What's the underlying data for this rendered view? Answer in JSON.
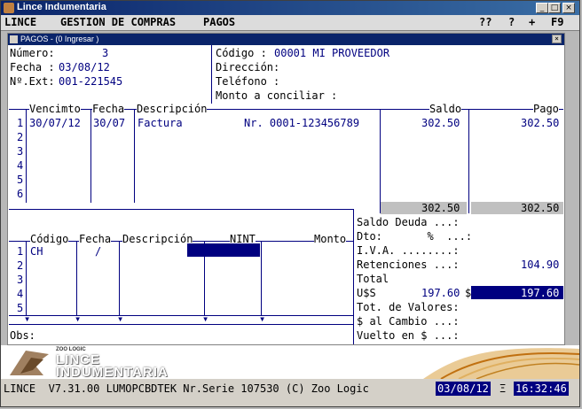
{
  "window": {
    "title": "Lince Indumentaria",
    "min": "_",
    "max": "□",
    "close": "×"
  },
  "menu": {
    "items": [
      "LINCE",
      "GESTION DE COMPRAS",
      "PAGOS"
    ],
    "right": [
      "??",
      "?",
      "+",
      "F9"
    ]
  },
  "subwindow": {
    "title": "PAGOS - (0  Ingresar )",
    "close": "×"
  },
  "header": {
    "numero_label": "Número:",
    "numero_value": "3",
    "fecha_label": "Fecha :",
    "fecha_value": "03/08/12",
    "next_label": "Nº.Ext:",
    "next_value": "001-221545",
    "codigo_label": "Código :",
    "codigo_value": "00001 MI PROVEEDOR",
    "direccion_label": "Dirección:",
    "telefono_label": "Teléfono :",
    "monto_label": "Monto a conciliar :"
  },
  "grid1": {
    "headers": {
      "vencimto": "Vencimto",
      "fecha": "Fecha",
      "descripcion": "Descripción",
      "saldo": "Saldo",
      "pago": "Pago"
    },
    "row_numbers": [
      "1",
      "2",
      "3",
      "4",
      "5",
      "6"
    ],
    "row1": {
      "vencimto": "30/07/12",
      "fecha": "30/07",
      "descripcion": "Factura",
      "nro": "Nr. 0001-123456789",
      "saldo": "302.50",
      "pago": "302.50"
    },
    "totals": {
      "saldo": "302.50",
      "pago": "302.50"
    }
  },
  "grid2": {
    "headers": {
      "codigo": "Código",
      "fecha": "Fecha",
      "descripcion": "Descripción",
      "nint": "NINT",
      "monto": "Monto"
    },
    "row_numbers": [
      "1",
      "2",
      "3",
      "4",
      "5"
    ],
    "row1": {
      "codigo": "CH",
      "fecha": "/"
    }
  },
  "summary": {
    "saldo_deuda": "Saldo Deuda ...:",
    "dto": "Dto:       %  ...:",
    "iva": "I.V.A. ........:",
    "retenciones": "Retenciones ...:",
    "retenciones_value": "104.90",
    "total": "Total",
    "uss": "U$S",
    "uss_value": "197.60",
    "uss_sep": "$",
    "total_value": "197.60",
    "tot_valores": "Tot. de Valores:",
    "al_cambio": "$ al Cambio ...:",
    "vuelto": "Vuelto en $ ...:"
  },
  "obs_label": "Obs:",
  "logo": {
    "small": "ZOO LOGIC",
    "line1": "LINCE",
    "line2": "INDUMENTARIA"
  },
  "status": {
    "text": "LINCE  V7.31.00 LUMOPCBDTEK Nr.Serie 107530 (C) Zoo Logic",
    "date": "03/08/12",
    "sep": "Ξ",
    "time": "16:32:46"
  },
  "colors": {
    "navy": "#000080",
    "title": "#0a246a"
  }
}
